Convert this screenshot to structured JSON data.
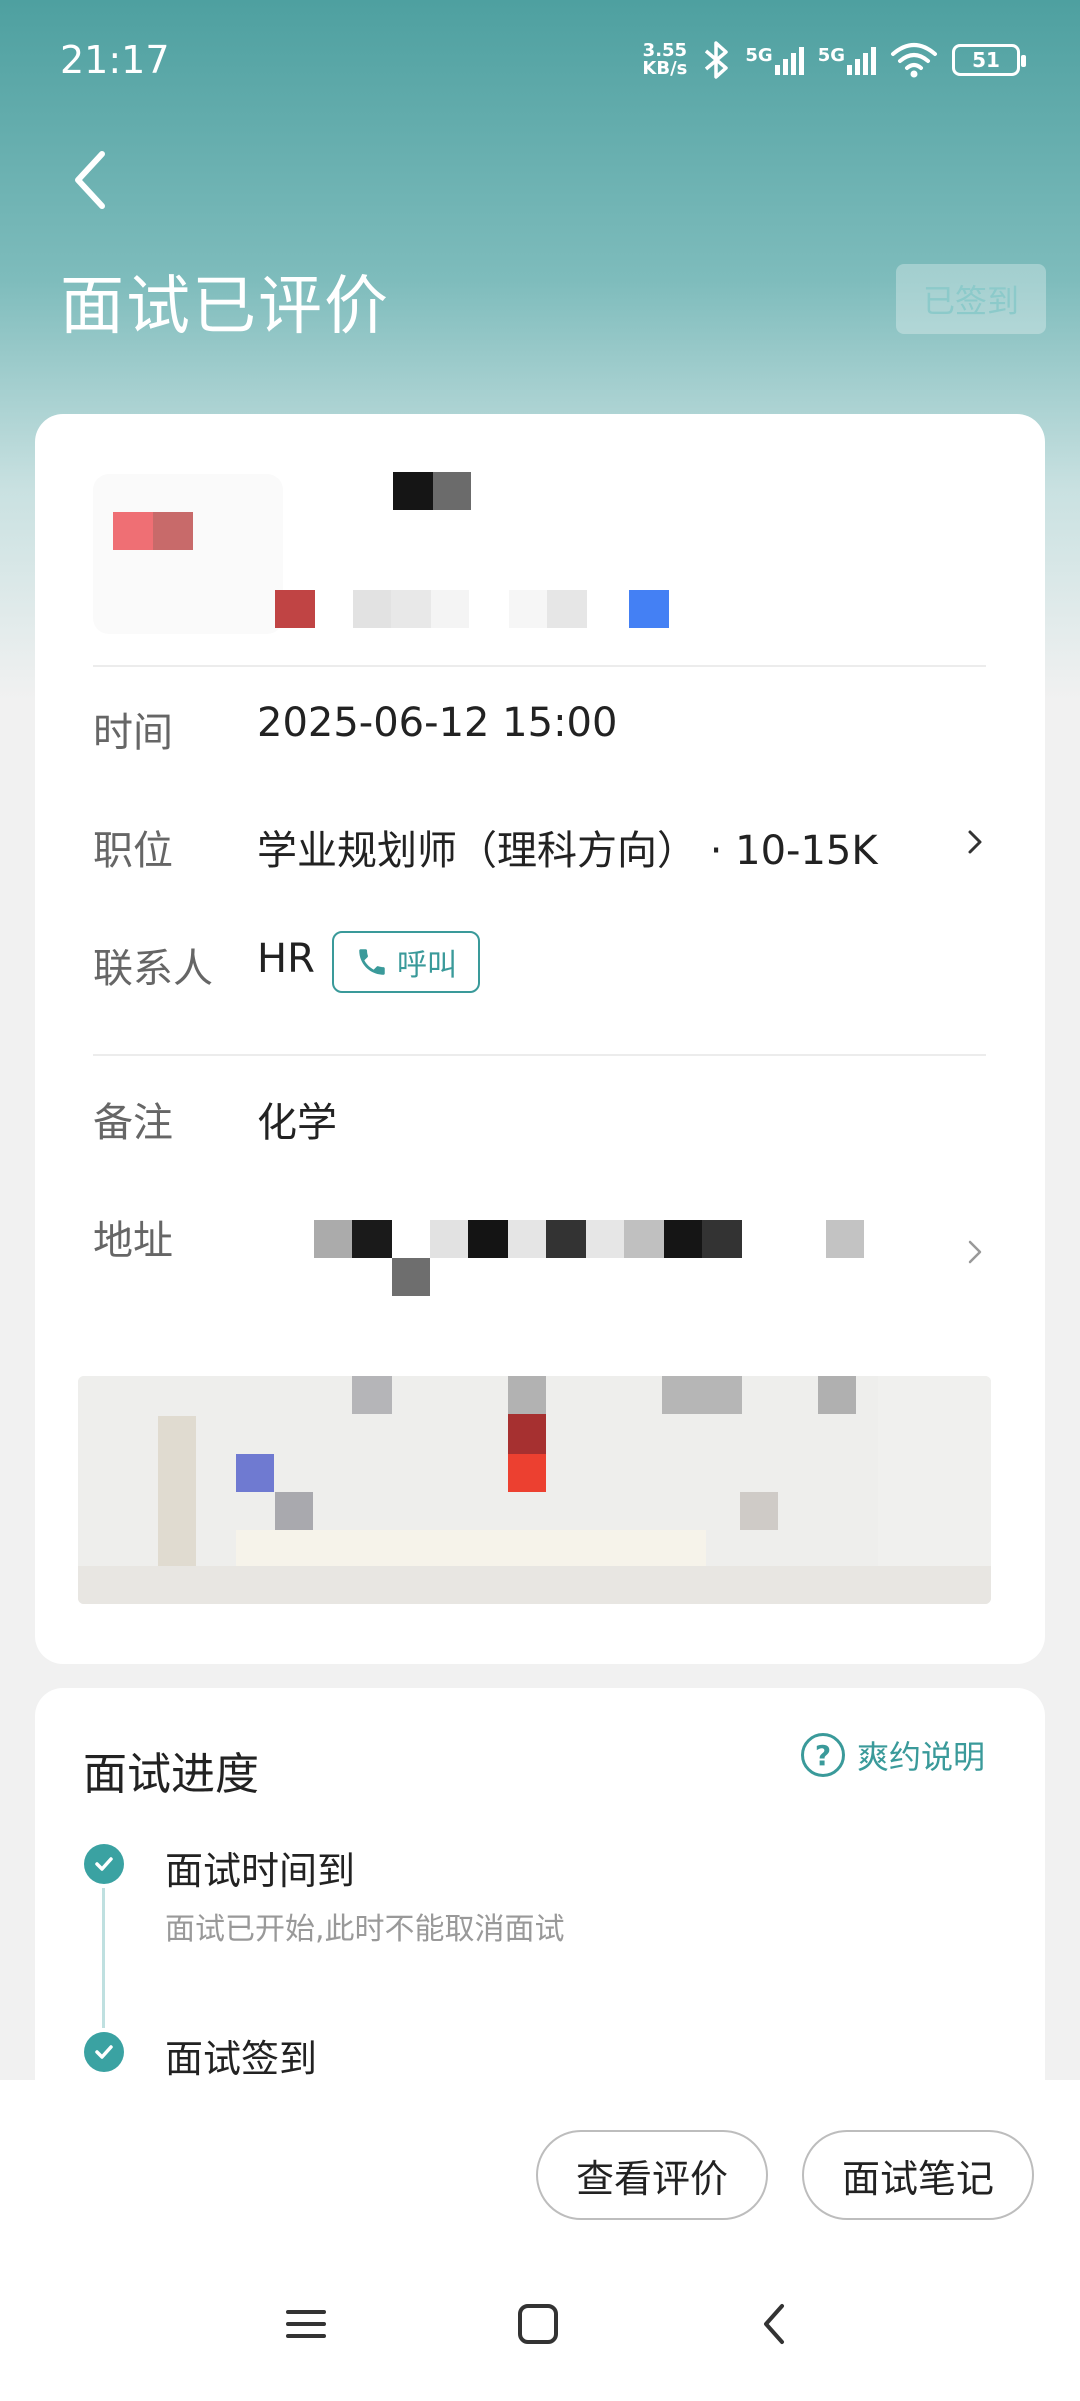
{
  "status_bar": {
    "time": "21:17",
    "net_speed_value": "3.55",
    "net_speed_unit": "KB/s",
    "sig1_label": "5G",
    "sig2_label": "5G",
    "battery": "51"
  },
  "header": {
    "title": "面试已评价",
    "checkin_badge": "已签到"
  },
  "info": {
    "time_label": "时间",
    "time_value": "2025-06-12 15:00",
    "position_label": "职位",
    "position_value": "学业规划师（理科方向） · 10-15K",
    "contact_label": "联系人",
    "contact_value": "HR",
    "call_label": "呼叫",
    "note_label": "备注",
    "note_value": "化学",
    "address_label": "地址"
  },
  "progress": {
    "title": "面试进度",
    "help_label": "爽约说明",
    "steps": [
      {
        "title": "面试时间到",
        "desc": "面试已开始,此时不能取消面试"
      },
      {
        "title": "面试签到",
        "desc": ""
      }
    ]
  },
  "actions": {
    "view_review": "查看评价",
    "notes": "面试笔记"
  },
  "colors": {
    "accent": "#3a9a9a",
    "header_gradient_top": "#4ea0a0",
    "page_bg": "#f1f1f1"
  }
}
